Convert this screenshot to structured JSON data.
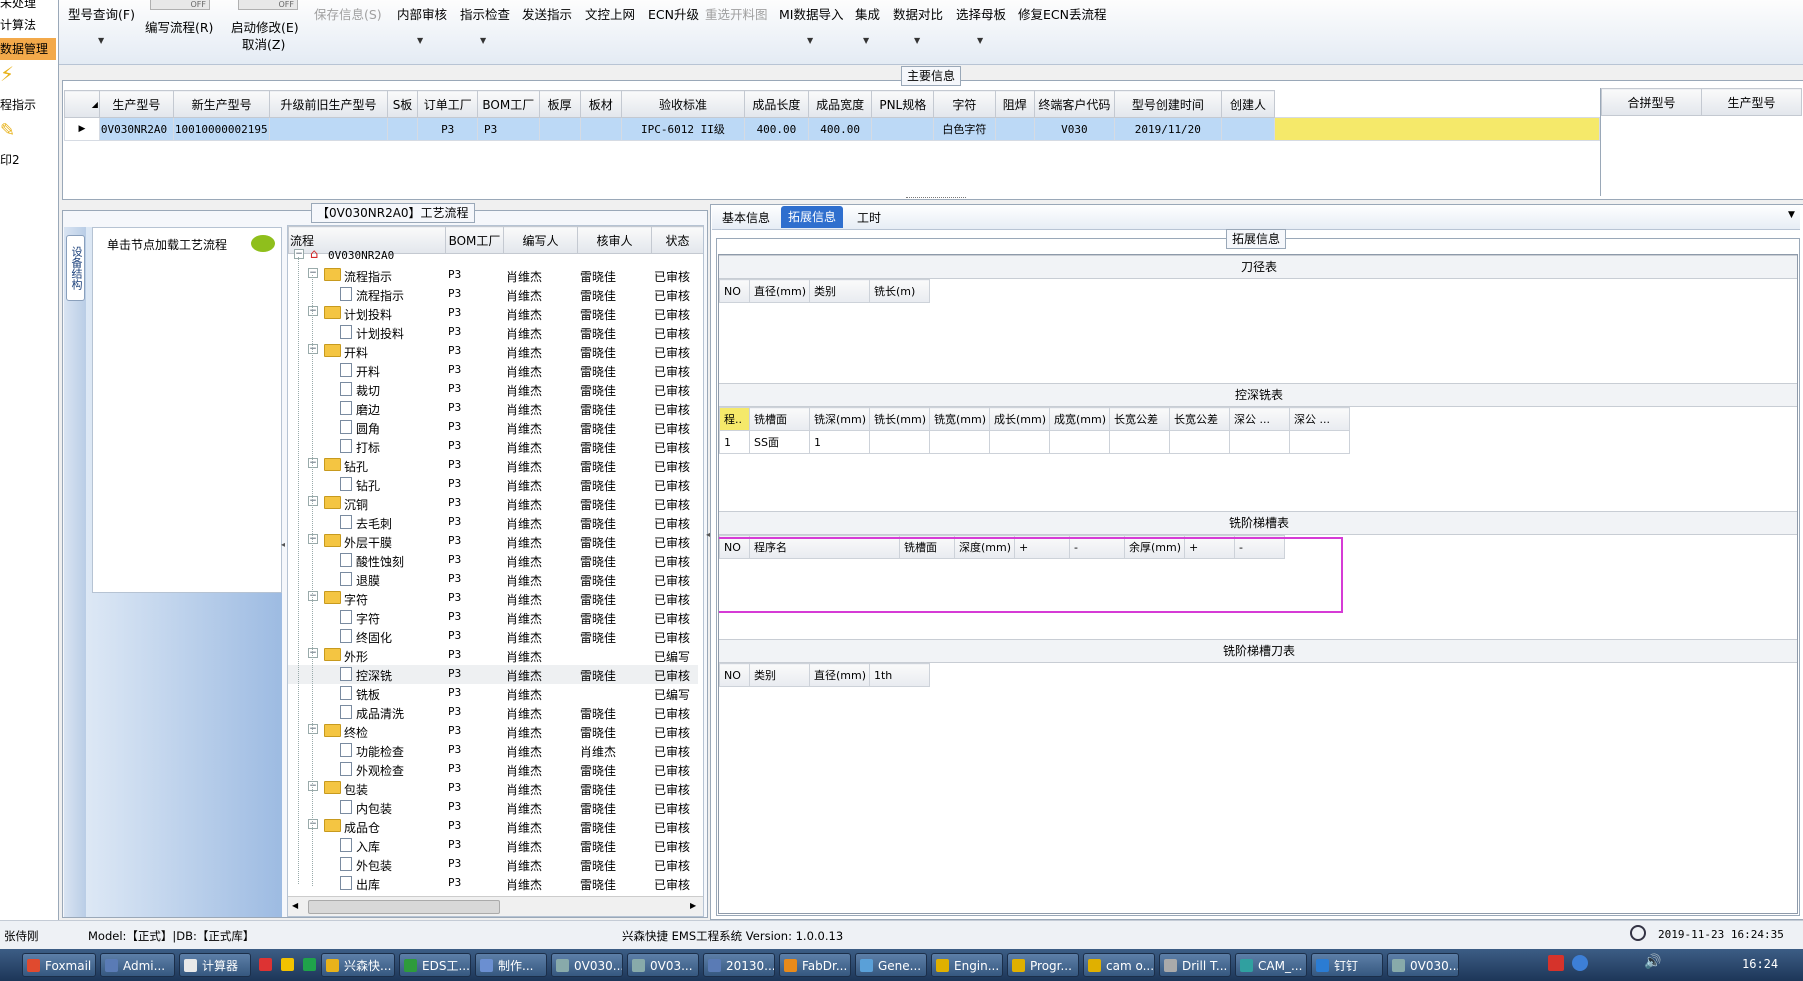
{
  "toolbar": {
    "items": [
      "型号查询(F)",
      "编写流程(R)",
      "启动修改(E)",
      "取消(Z)",
      "保存信息(S)",
      "内部审核",
      "指示检查",
      "发送指示",
      "文控上网",
      "ECN升级",
      "重选开料图",
      "MI数据导入",
      "集成",
      "数据对比",
      "选择母板",
      "修复ECN丢流程"
    ],
    "toggle_label": "OFF"
  },
  "left_strip": {
    "items": [
      "未处理",
      "计算法",
      "数据管理",
      "程指示",
      "印2"
    ]
  },
  "main_info": {
    "title": "主要信息",
    "columns": [
      "生产型号",
      "新生产型号",
      "升级前旧生产型号",
      "S板",
      "订单工厂",
      "BOM工厂",
      "板厚",
      "板材",
      "验收标准",
      "成品长度",
      "成品宽度",
      "PNL规格",
      "字符",
      "阻焊",
      "终端客户代码",
      "型号创建时间",
      "创建人"
    ],
    "row": [
      "0V030NR2A0",
      "10010000002195",
      "",
      "",
      "P3",
      "P3",
      "",
      "",
      "IPC-6012 II级",
      "400.00",
      "400.00",
      "",
      "白色字符",
      "",
      "V030",
      "2019/11/20",
      ""
    ],
    "side_columns": [
      "合拼型号",
      "生产型号"
    ]
  },
  "process": {
    "title": "【0V030NR2A0】工艺流程",
    "side_tab": "设备结构",
    "hint": "单击节点加载工艺流程",
    "columns": [
      "流程",
      "BOM工厂",
      "编写人",
      "核审人",
      "状态"
    ],
    "root": "0V030NR2A0",
    "rows": [
      {
        "name": "流程指示",
        "level": 1,
        "bom": "P3",
        "writer": "肖维杰",
        "reviewer": "雷晓佳",
        "status": "已审核"
      },
      {
        "name": "流程指示",
        "level": 2,
        "bom": "P3",
        "writer": "肖维杰",
        "reviewer": "雷晓佳",
        "status": "已审核"
      },
      {
        "name": "计划投料",
        "level": 1,
        "bom": "P3",
        "writer": "肖维杰",
        "reviewer": "雷晓佳",
        "status": "已审核"
      },
      {
        "name": "计划投料",
        "level": 2,
        "bom": "P3",
        "writer": "肖维杰",
        "reviewer": "雷晓佳",
        "status": "已审核"
      },
      {
        "name": "开料",
        "level": 1,
        "bom": "P3",
        "writer": "肖维杰",
        "reviewer": "雷晓佳",
        "status": "已审核"
      },
      {
        "name": "开料",
        "level": 2,
        "bom": "P3",
        "writer": "肖维杰",
        "reviewer": "雷晓佳",
        "status": "已审核"
      },
      {
        "name": "裁切",
        "level": 2,
        "bom": "P3",
        "writer": "肖维杰",
        "reviewer": "雷晓佳",
        "status": "已审核"
      },
      {
        "name": "磨边",
        "level": 2,
        "bom": "P3",
        "writer": "肖维杰",
        "reviewer": "雷晓佳",
        "status": "已审核"
      },
      {
        "name": "圆角",
        "level": 2,
        "bom": "P3",
        "writer": "肖维杰",
        "reviewer": "雷晓佳",
        "status": "已审核"
      },
      {
        "name": "打标",
        "level": 2,
        "bom": "P3",
        "writer": "肖维杰",
        "reviewer": "雷晓佳",
        "status": "已审核"
      },
      {
        "name": "钻孔",
        "level": 1,
        "bom": "P3",
        "writer": "肖维杰",
        "reviewer": "雷晓佳",
        "status": "已审核"
      },
      {
        "name": "钻孔",
        "level": 2,
        "bom": "P3",
        "writer": "肖维杰",
        "reviewer": "雷晓佳",
        "status": "已审核"
      },
      {
        "name": "沉铜",
        "level": 1,
        "bom": "P3",
        "writer": "肖维杰",
        "reviewer": "雷晓佳",
        "status": "已审核"
      },
      {
        "name": "去毛刺",
        "level": 2,
        "bom": "P3",
        "writer": "肖维杰",
        "reviewer": "雷晓佳",
        "status": "已审核"
      },
      {
        "name": "外层干膜",
        "level": 1,
        "bom": "P3",
        "writer": "肖维杰",
        "reviewer": "雷晓佳",
        "status": "已审核"
      },
      {
        "name": "酸性蚀刻",
        "level": 2,
        "bom": "P3",
        "writer": "肖维杰",
        "reviewer": "雷晓佳",
        "status": "已审核"
      },
      {
        "name": "退膜",
        "level": 2,
        "bom": "P3",
        "writer": "肖维杰",
        "reviewer": "雷晓佳",
        "status": "已审核"
      },
      {
        "name": "字符",
        "level": 1,
        "bom": "P3",
        "writer": "肖维杰",
        "reviewer": "雷晓佳",
        "status": "已审核"
      },
      {
        "name": "字符",
        "level": 2,
        "bom": "P3",
        "writer": "肖维杰",
        "reviewer": "雷晓佳",
        "status": "已审核"
      },
      {
        "name": "终固化",
        "level": 2,
        "bom": "P3",
        "writer": "肖维杰",
        "reviewer": "雷晓佳",
        "status": "已审核"
      },
      {
        "name": "外形",
        "level": 1,
        "bom": "P3",
        "writer": "肖维杰",
        "reviewer": "",
        "status": "已编写"
      },
      {
        "name": "控深铣",
        "level": 2,
        "bom": "P3",
        "writer": "肖维杰",
        "reviewer": "雷晓佳",
        "status": "已审核"
      },
      {
        "name": "铣板",
        "level": 2,
        "bom": "P3",
        "writer": "肖维杰",
        "reviewer": "",
        "status": "已编写"
      },
      {
        "name": "成品清洗",
        "level": 2,
        "bom": "P3",
        "writer": "肖维杰",
        "reviewer": "雷晓佳",
        "status": "已审核"
      },
      {
        "name": "终检",
        "level": 1,
        "bom": "P3",
        "writer": "肖维杰",
        "reviewer": "雷晓佳",
        "status": "已审核"
      },
      {
        "name": "功能检查",
        "level": 2,
        "bom": "P3",
        "writer": "肖维杰",
        "reviewer": "肖维杰",
        "status": "已审核"
      },
      {
        "name": "外观检查",
        "level": 2,
        "bom": "P3",
        "writer": "肖维杰",
        "reviewer": "雷晓佳",
        "status": "已审核"
      },
      {
        "name": "包装",
        "level": 1,
        "bom": "P3",
        "writer": "肖维杰",
        "reviewer": "雷晓佳",
        "status": "已审核"
      },
      {
        "name": "内包装",
        "level": 2,
        "bom": "P3",
        "writer": "肖维杰",
        "reviewer": "雷晓佳",
        "status": "已审核"
      },
      {
        "name": "成品仓",
        "level": 1,
        "bom": "P3",
        "writer": "肖维杰",
        "reviewer": "雷晓佳",
        "status": "已审核"
      },
      {
        "name": "入库",
        "level": 2,
        "bom": "P3",
        "writer": "肖维杰",
        "reviewer": "雷晓佳",
        "status": "已审核"
      },
      {
        "name": "外包装",
        "level": 2,
        "bom": "P3",
        "writer": "肖维杰",
        "reviewer": "雷晓佳",
        "status": "已审核"
      },
      {
        "name": "出库",
        "level": 2,
        "bom": "P3",
        "writer": "肖维杰",
        "reviewer": "雷晓佳",
        "status": "已审核"
      }
    ]
  },
  "tabs": [
    "基本信息",
    "拓展信息",
    "工时"
  ],
  "ext": {
    "title": "拓展信息",
    "cutter": {
      "title": "刀径表",
      "columns": [
        "NO",
        "直径(mm)",
        "类别",
        "铣长(m)"
      ]
    },
    "depth_mill": {
      "title": "控深铣表",
      "columns": [
        "程..",
        "铣槽面",
        "铣深(mm)",
        "铣长(mm)",
        "铣宽(mm)",
        "成长(mm)",
        "成宽(mm)",
        "长宽公差",
        "长宽公差",
        "深公 ...",
        "深公 ..."
      ],
      "row": [
        "1",
        "SS面",
        "1",
        "",
        "",
        "",
        "",
        "",
        "",
        "",
        ""
      ]
    },
    "step_slot": {
      "title": "铣阶梯槽表",
      "columns": [
        "NO",
        "程序名",
        "铣槽面",
        "深度(mm)",
        "+",
        "-",
        "余厚(mm)",
        "+",
        "-"
      ]
    },
    "step_cutter": {
      "title": "铣阶梯槽刀表",
      "columns": [
        "NO",
        "类别",
        "直径(mm)",
        "1th"
      ]
    }
  },
  "status": {
    "user": "张侍刚",
    "model": "Model:【正式】|DB:【正式库】",
    "app": "兴森快捷 EMS工程系统 Version: 1.0.0.13",
    "datetime": "2019-11-23 16:24:35"
  },
  "taskbar": {
    "tasks": [
      "Foxmail",
      "Admi...",
      "计算器",
      "",
      "",
      "",
      "兴森快...",
      "EDS工...",
      "制作...",
      "0V030...",
      "0V03...",
      "20130...",
      "FabDr...",
      "Gene...",
      "Engin...",
      "Progr...",
      "cam o...",
      "Drill T...",
      "CAM_...",
      "钉钉",
      "0V030..."
    ],
    "clock": "16:24"
  },
  "colors": {
    "selection": "#bcd9f6",
    "row_highlight_yellow": "#f5e96a",
    "annotation_box": "#d63bd6",
    "active_tab": "#2f6fce"
  }
}
